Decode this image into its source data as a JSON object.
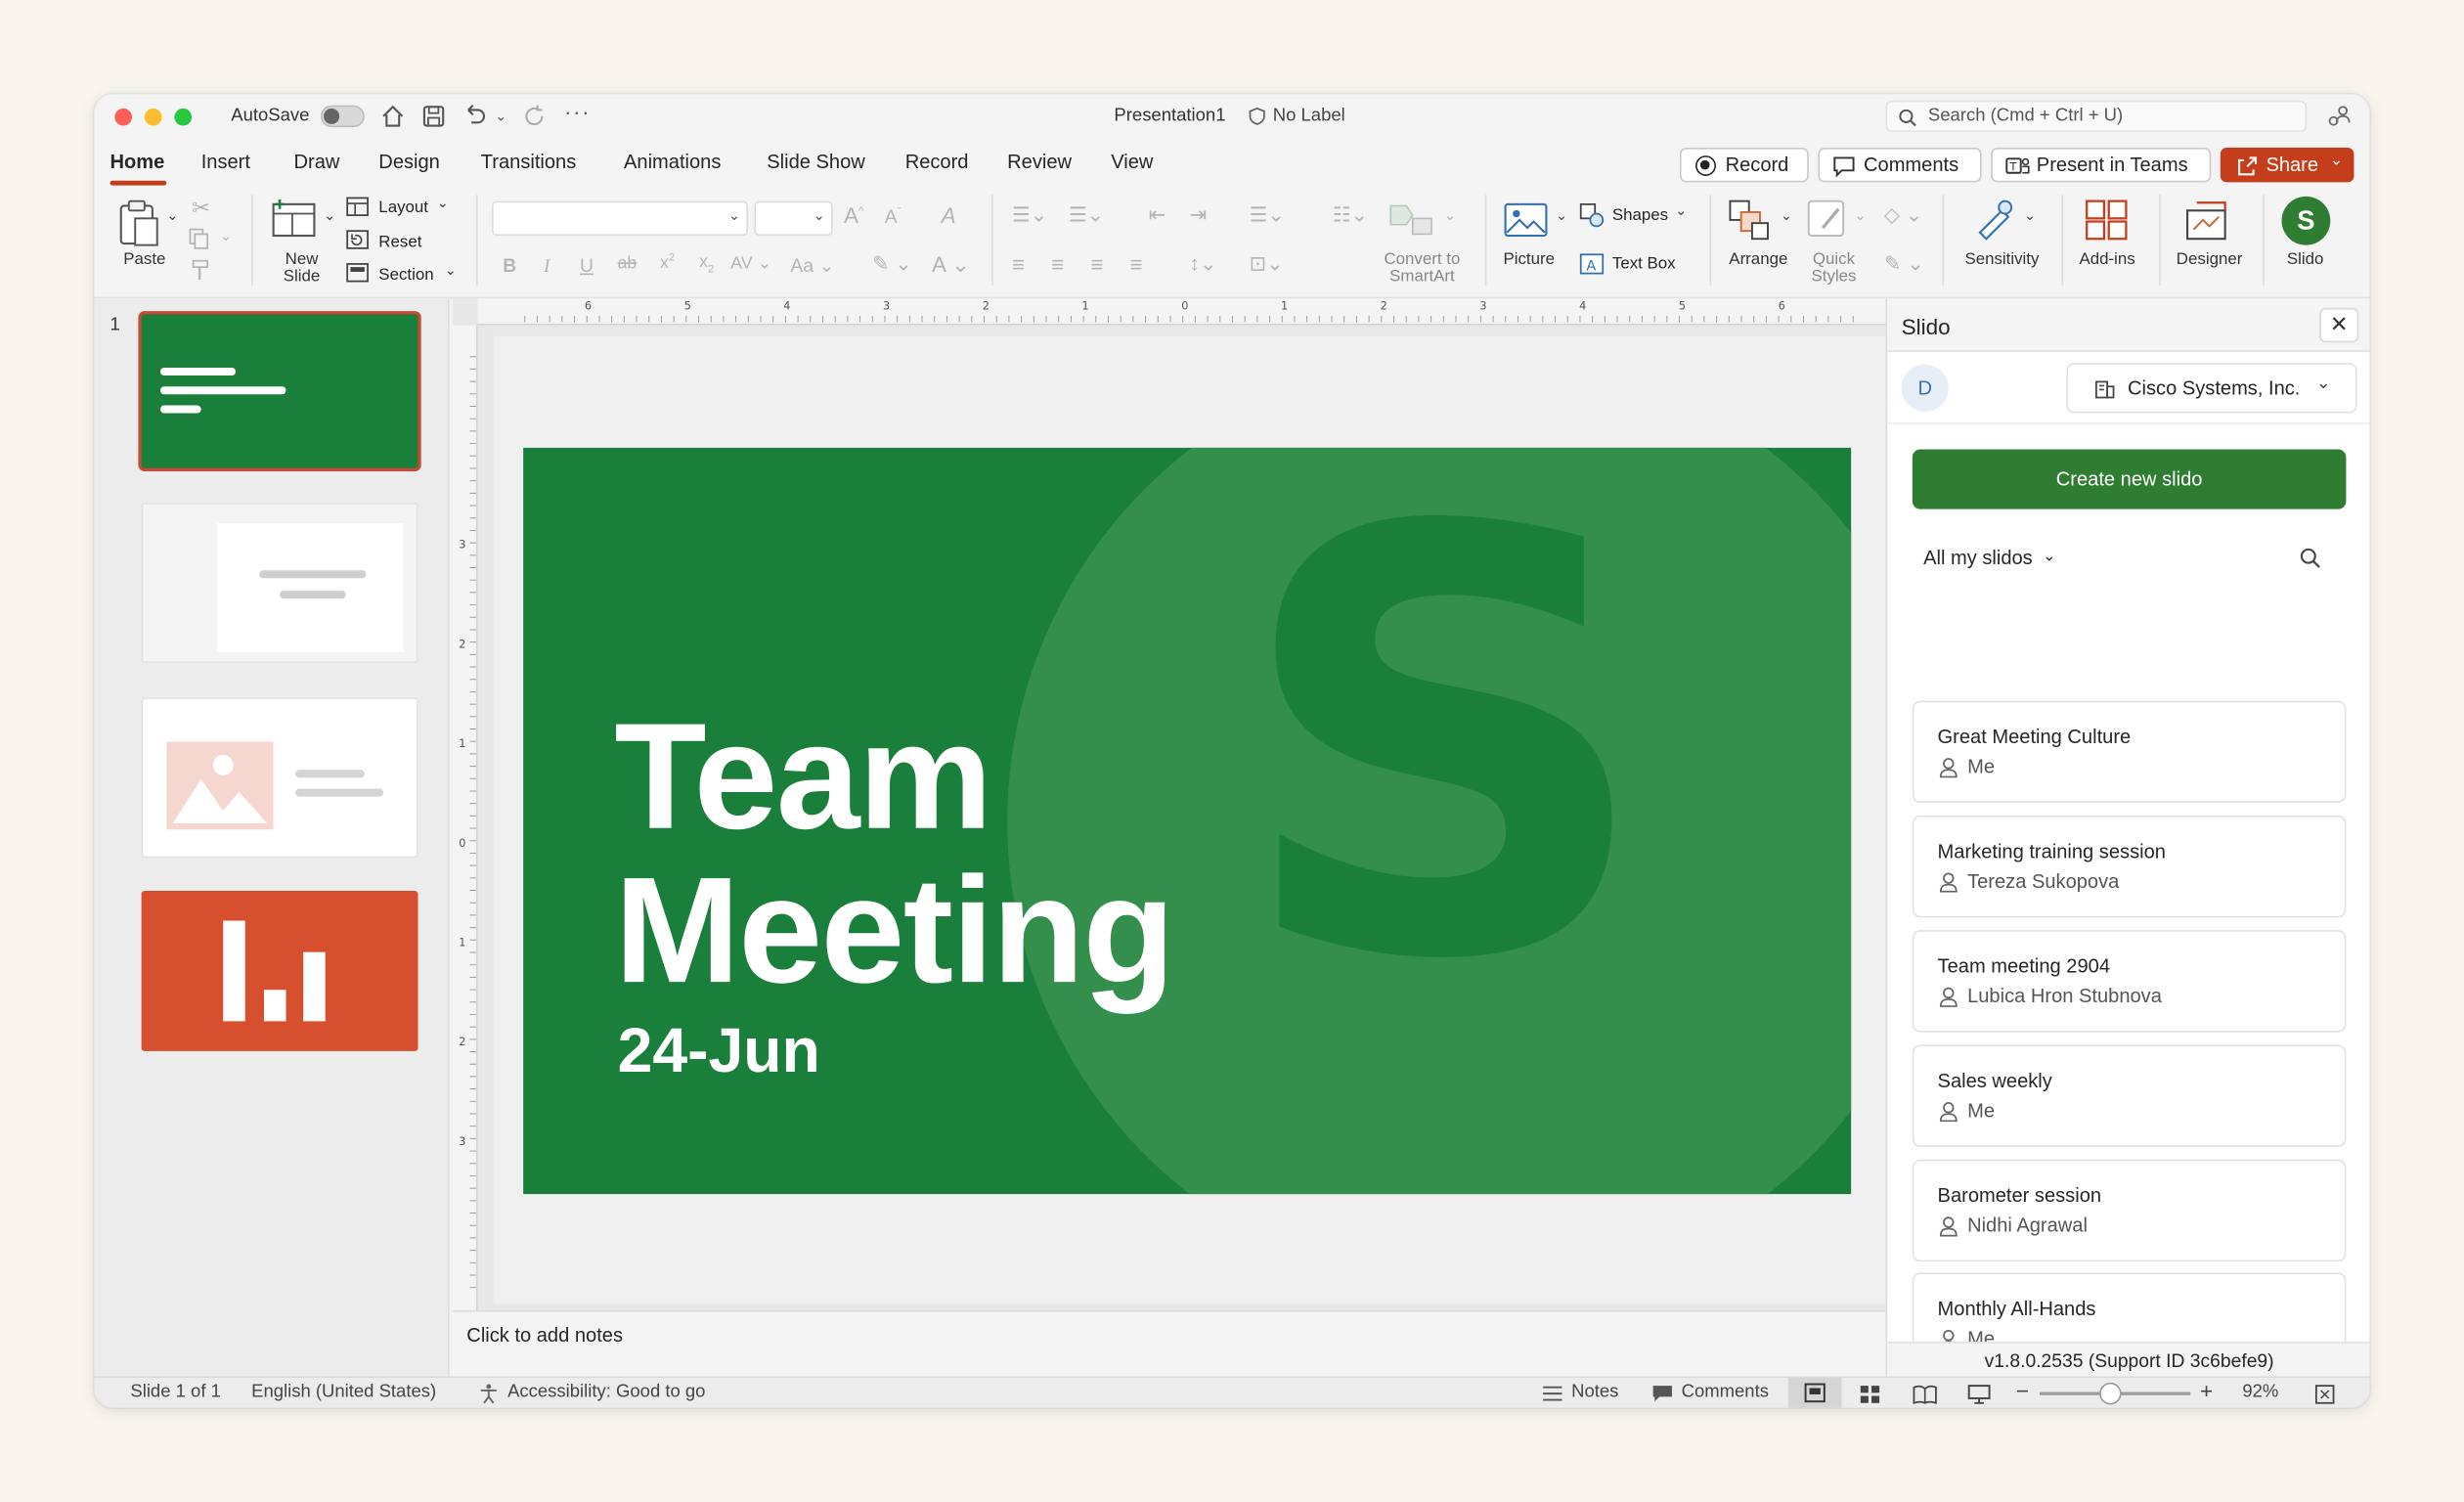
{
  "titlebar": {
    "autosave_label": "AutoSave",
    "document_title": "Presentation1",
    "sensitivity_label": "No Label",
    "search_placeholder": "Search (Cmd + Ctrl + U)"
  },
  "tabs": [
    {
      "label": "Home",
      "active": true
    },
    {
      "label": "Insert"
    },
    {
      "label": "Draw"
    },
    {
      "label": "Design"
    },
    {
      "label": "Transitions"
    },
    {
      "label": "Animations"
    },
    {
      "label": "Slide Show"
    },
    {
      "label": "Record"
    },
    {
      "label": "Review"
    },
    {
      "label": "View"
    }
  ],
  "top_actions": {
    "record": "Record",
    "comments": "Comments",
    "present_in_teams": "Present in Teams",
    "share": "Share"
  },
  "ribbon": {
    "paste": "Paste",
    "new_slide_1": "New",
    "new_slide_2": "Slide",
    "layout": "Layout",
    "reset": "Reset",
    "section": "Section",
    "convert_smartart_1": "Convert to",
    "convert_smartart_2": "SmartArt",
    "picture": "Picture",
    "shapes": "Shapes",
    "text_box": "Text Box",
    "arrange": "Arrange",
    "quick_styles_1": "Quick",
    "quick_styles_2": "Styles",
    "sensitivity": "Sensitivity",
    "add_ins": "Add-ins",
    "designer": "Designer",
    "slido": "Slido",
    "slido_badge": "S"
  },
  "thumbnails": {
    "first_number": "1"
  },
  "ruler_numbers": [
    "6",
    "5",
    "4",
    "3",
    "2",
    "1",
    "0",
    "1",
    "2",
    "3",
    "4",
    "5",
    "6"
  ],
  "vruler_numbers": [
    "3",
    "2",
    "1",
    "0",
    "1",
    "2",
    "3"
  ],
  "slide": {
    "title_line1": "Team",
    "title_line2": "Meeting",
    "subtitle": "24-Jun",
    "logo_letter": "S",
    "background_color": "#1a7f3b"
  },
  "notes_placeholder": "Click to add notes",
  "slido_panel": {
    "title": "Slido",
    "user_initial": "D",
    "org": "Cisco Systems, Inc.",
    "create_button": "Create new slido",
    "filter": "All my slidos",
    "items": [
      {
        "title": "Great Meeting Culture",
        "owner": "Me"
      },
      {
        "title": "Marketing training session",
        "owner": "Tereza Sukopova"
      },
      {
        "title": "Team meeting 2904",
        "owner": "Lubica Hron Stubnova"
      },
      {
        "title": "Sales weekly",
        "owner": "Me"
      },
      {
        "title": "Barometer session",
        "owner": "Nidhi Agrawal"
      },
      {
        "title": "Monthly All-Hands",
        "owner": "Me"
      }
    ],
    "version": "v1.8.0.2535 (Support ID 3c6befe9)"
  },
  "statusbar": {
    "slide_count": "Slide 1 of 1",
    "language": "English (United States)",
    "accessibility": "Accessibility: Good to go",
    "notes": "Notes",
    "comments": "Comments",
    "zoom": "92%"
  },
  "colors": {
    "accent": "#c43e1c",
    "slido_green": "#2e7d32",
    "slide_green": "#1a7f3b"
  }
}
